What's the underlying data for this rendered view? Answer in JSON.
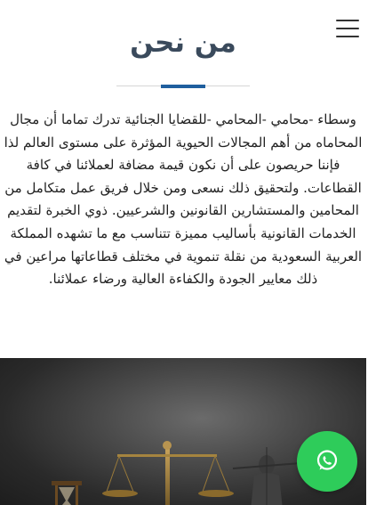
{
  "header": {
    "menu_icon": "hamburger-menu-icon"
  },
  "about": {
    "title": "من نحن",
    "accent_color": "#1f5f9e",
    "body": "وسطاء -محامي -المحامي -للقضايا الجنائية تدرك تماما أن مجال المحاماه من أهم المجالات الحيوية المؤثرة على مستوى العالم لذا فإننا حريصون على أن نكون قيمة مضافة لعملائنا في كافة القطاعات. ولتحقيق ذلك نسعى ومن خلال فريق عمل متكامل من المحامين والمستشارين القانونين والشرعيين. ذوي الخبرة لتقديم الخدمات القانونية بأساليب مميزة تتناسب مع ما تشهده المملكة العربية السعودية من نقلة تنموية في مختلف قطاعاتها مراعين في ذلك معايير الجودة والكفاءة العالية ورضاء عملائنا."
  },
  "hero_image": {
    "description_icon": "scales-of-justice-image"
  },
  "whatsapp": {
    "icon": "whatsapp-icon",
    "color": "#2ecc5a"
  }
}
